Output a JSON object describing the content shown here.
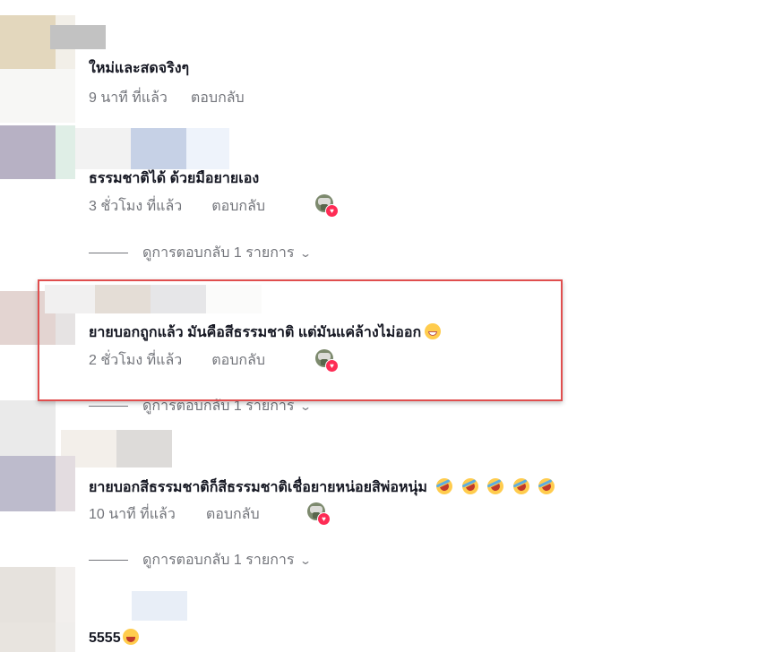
{
  "colors": {
    "text_primary": "#161823",
    "text_secondary": "#73757b",
    "highlight_border": "#e04e4e",
    "heart": "#fe2c55"
  },
  "comments": [
    {
      "text": "ใหม่และสดจริงๆ",
      "time": "9 นาที ที่แล้ว",
      "reply": "ตอบกลับ",
      "liked_by_creator": false,
      "view_replies": null
    },
    {
      "text": "ธรรมชาติได้ ด้วยมือยายเอง",
      "time": "3 ชั่วโมง ที่แล้ว",
      "reply": "ตอบกลับ",
      "liked_by_creator": true,
      "view_replies": "ดูการตอบกลับ 1 รายการ"
    },
    {
      "text": "ยายบอกถูกแล้ว มันคือสีธรรมชาติ แต่มันแค่ล้างไม่ออก",
      "emoji": "grinning-face-icon",
      "time": "2 ชั่วโมง ที่แล้ว",
      "reply": "ตอบกลับ",
      "liked_by_creator": true,
      "highlighted": true,
      "view_replies": "ดูการตอบกลับ 1 รายการ"
    },
    {
      "text": "ยายบอกสีธรรมชาติก็สีธรรมชาติเชื่อยายหน่อยสิพ่อหนุ่ม",
      "emoji": "rolling-on-floor-laughing-icon x5",
      "time": "10 นาที ที่แล้ว",
      "reply": "ตอบกลับ",
      "liked_by_creator": true,
      "view_replies": "ดูการตอบกลับ 1 รายการ"
    },
    {
      "text": "5555",
      "emoji": "laughing-face-icon"
    }
  ]
}
